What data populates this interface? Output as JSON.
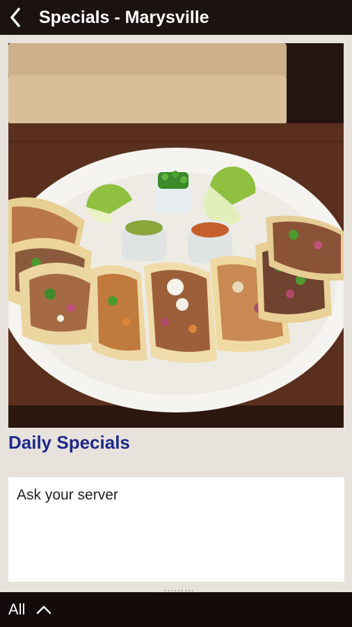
{
  "header": {
    "title": "Specials - Marysville",
    "back_icon": "back-arrow-icon"
  },
  "photo": {
    "subject": "plate of tacos with limes and salsas"
  },
  "section": {
    "title": "Daily Specials",
    "body": "Ask your server"
  },
  "pager": {
    "total_dots": 10,
    "active_index": 0
  },
  "bottom_bar": {
    "all_label": "All",
    "expand_icon": "chevron-up-icon"
  },
  "colors": {
    "topbar": "#1c1210",
    "background": "#e7e3dc",
    "heading": "#1e2a88",
    "bottombar": "#140c0a"
  }
}
